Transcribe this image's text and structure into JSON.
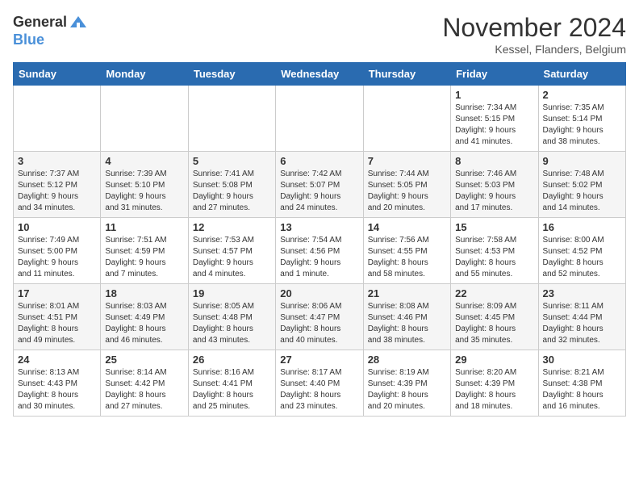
{
  "logo": {
    "general": "General",
    "blue": "Blue"
  },
  "title": "November 2024",
  "location": "Kessel, Flanders, Belgium",
  "weekdays": [
    "Sunday",
    "Monday",
    "Tuesday",
    "Wednesday",
    "Thursday",
    "Friday",
    "Saturday"
  ],
  "weeks": [
    [
      {
        "day": "",
        "detail": ""
      },
      {
        "day": "",
        "detail": ""
      },
      {
        "day": "",
        "detail": ""
      },
      {
        "day": "",
        "detail": ""
      },
      {
        "day": "",
        "detail": ""
      },
      {
        "day": "1",
        "detail": "Sunrise: 7:34 AM\nSunset: 5:15 PM\nDaylight: 9 hours\nand 41 minutes."
      },
      {
        "day": "2",
        "detail": "Sunrise: 7:35 AM\nSunset: 5:14 PM\nDaylight: 9 hours\nand 38 minutes."
      }
    ],
    [
      {
        "day": "3",
        "detail": "Sunrise: 7:37 AM\nSunset: 5:12 PM\nDaylight: 9 hours\nand 34 minutes."
      },
      {
        "day": "4",
        "detail": "Sunrise: 7:39 AM\nSunset: 5:10 PM\nDaylight: 9 hours\nand 31 minutes."
      },
      {
        "day": "5",
        "detail": "Sunrise: 7:41 AM\nSunset: 5:08 PM\nDaylight: 9 hours\nand 27 minutes."
      },
      {
        "day": "6",
        "detail": "Sunrise: 7:42 AM\nSunset: 5:07 PM\nDaylight: 9 hours\nand 24 minutes."
      },
      {
        "day": "7",
        "detail": "Sunrise: 7:44 AM\nSunset: 5:05 PM\nDaylight: 9 hours\nand 20 minutes."
      },
      {
        "day": "8",
        "detail": "Sunrise: 7:46 AM\nSunset: 5:03 PM\nDaylight: 9 hours\nand 17 minutes."
      },
      {
        "day": "9",
        "detail": "Sunrise: 7:48 AM\nSunset: 5:02 PM\nDaylight: 9 hours\nand 14 minutes."
      }
    ],
    [
      {
        "day": "10",
        "detail": "Sunrise: 7:49 AM\nSunset: 5:00 PM\nDaylight: 9 hours\nand 11 minutes."
      },
      {
        "day": "11",
        "detail": "Sunrise: 7:51 AM\nSunset: 4:59 PM\nDaylight: 9 hours\nand 7 minutes."
      },
      {
        "day": "12",
        "detail": "Sunrise: 7:53 AM\nSunset: 4:57 PM\nDaylight: 9 hours\nand 4 minutes."
      },
      {
        "day": "13",
        "detail": "Sunrise: 7:54 AM\nSunset: 4:56 PM\nDaylight: 9 hours\nand 1 minute."
      },
      {
        "day": "14",
        "detail": "Sunrise: 7:56 AM\nSunset: 4:55 PM\nDaylight: 8 hours\nand 58 minutes."
      },
      {
        "day": "15",
        "detail": "Sunrise: 7:58 AM\nSunset: 4:53 PM\nDaylight: 8 hours\nand 55 minutes."
      },
      {
        "day": "16",
        "detail": "Sunrise: 8:00 AM\nSunset: 4:52 PM\nDaylight: 8 hours\nand 52 minutes."
      }
    ],
    [
      {
        "day": "17",
        "detail": "Sunrise: 8:01 AM\nSunset: 4:51 PM\nDaylight: 8 hours\nand 49 minutes."
      },
      {
        "day": "18",
        "detail": "Sunrise: 8:03 AM\nSunset: 4:49 PM\nDaylight: 8 hours\nand 46 minutes."
      },
      {
        "day": "19",
        "detail": "Sunrise: 8:05 AM\nSunset: 4:48 PM\nDaylight: 8 hours\nand 43 minutes."
      },
      {
        "day": "20",
        "detail": "Sunrise: 8:06 AM\nSunset: 4:47 PM\nDaylight: 8 hours\nand 40 minutes."
      },
      {
        "day": "21",
        "detail": "Sunrise: 8:08 AM\nSunset: 4:46 PM\nDaylight: 8 hours\nand 38 minutes."
      },
      {
        "day": "22",
        "detail": "Sunrise: 8:09 AM\nSunset: 4:45 PM\nDaylight: 8 hours\nand 35 minutes."
      },
      {
        "day": "23",
        "detail": "Sunrise: 8:11 AM\nSunset: 4:44 PM\nDaylight: 8 hours\nand 32 minutes."
      }
    ],
    [
      {
        "day": "24",
        "detail": "Sunrise: 8:13 AM\nSunset: 4:43 PM\nDaylight: 8 hours\nand 30 minutes."
      },
      {
        "day": "25",
        "detail": "Sunrise: 8:14 AM\nSunset: 4:42 PM\nDaylight: 8 hours\nand 27 minutes."
      },
      {
        "day": "26",
        "detail": "Sunrise: 8:16 AM\nSunset: 4:41 PM\nDaylight: 8 hours\nand 25 minutes."
      },
      {
        "day": "27",
        "detail": "Sunrise: 8:17 AM\nSunset: 4:40 PM\nDaylight: 8 hours\nand 23 minutes."
      },
      {
        "day": "28",
        "detail": "Sunrise: 8:19 AM\nSunset: 4:39 PM\nDaylight: 8 hours\nand 20 minutes."
      },
      {
        "day": "29",
        "detail": "Sunrise: 8:20 AM\nSunset: 4:39 PM\nDaylight: 8 hours\nand 18 minutes."
      },
      {
        "day": "30",
        "detail": "Sunrise: 8:21 AM\nSunset: 4:38 PM\nDaylight: 8 hours\nand 16 minutes."
      }
    ]
  ]
}
